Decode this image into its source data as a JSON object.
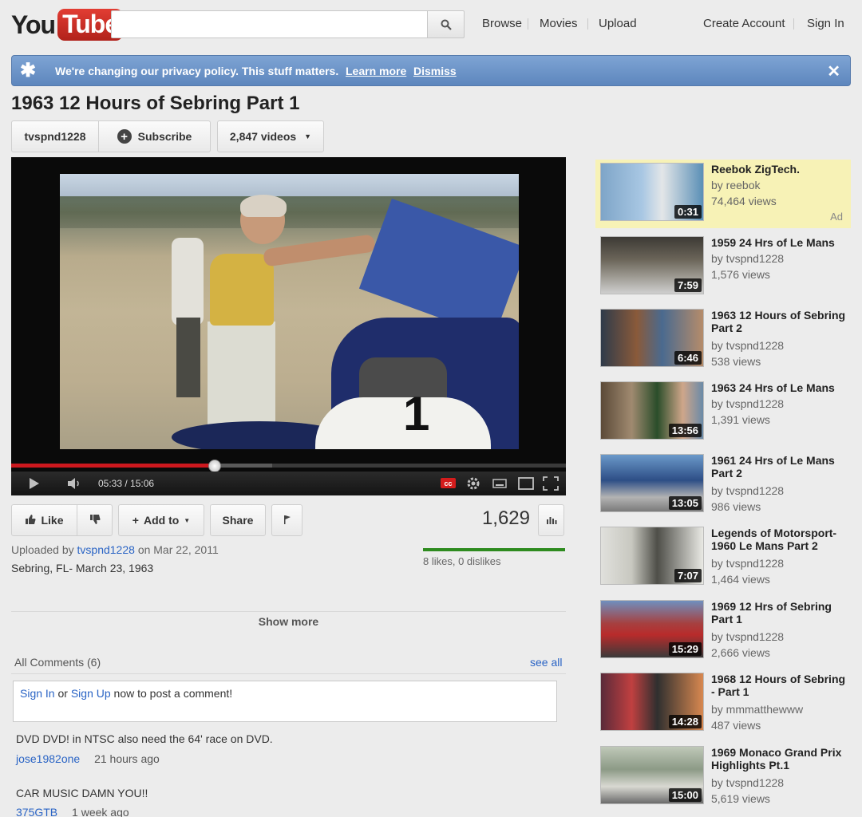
{
  "header": {
    "logo_you": "You",
    "logo_tube": "Tube",
    "search_value": "",
    "nav": [
      "Browse",
      "Movies",
      "Upload"
    ],
    "create_account": "Create Account",
    "sign_in": "Sign In"
  },
  "banner": {
    "text": "We're changing our privacy policy. This stuff matters.",
    "learn_more": "Learn more",
    "dismiss": "Dismiss",
    "color": "#6a92c8"
  },
  "video": {
    "title": "1963 12 Hours of Sebring Part 1",
    "channel": "tvspnd1228",
    "subscribe": "Subscribe",
    "video_count": "2,847 videos",
    "time_current": "05:33",
    "time_total": "15:06",
    "progress_played_fraction": 0.367,
    "progress_buffered_fraction": 0.47,
    "cc_label": "cc"
  },
  "actions": {
    "like": "Like",
    "add_to": "Add to",
    "share": "Share",
    "views": "1,629",
    "likes_text": "8 likes, 0 dislikes"
  },
  "info": {
    "uploaded_prefix": "Uploaded by",
    "uploader": "tvspnd1228",
    "uploaded_date": "on Mar 22, 2011",
    "description": "Sebring, FL- March 23, 1963",
    "show_more": "Show more"
  },
  "comments": {
    "header": "All Comments (6)",
    "see_all": "see all",
    "sign_in": "Sign In",
    "or": "or",
    "sign_up": "Sign Up",
    "prompt": "now to post a comment!",
    "items": [
      {
        "text": "DVD DVD! in NTSC also need the 64' race on DVD.",
        "user": "jose1982one",
        "time": "21 hours ago"
      },
      {
        "text": "CAR MUSIC DAMN YOU!!",
        "user": "375GTB",
        "time": "1 week ago"
      }
    ]
  },
  "sidebar": {
    "ad_label": "Ad",
    "items": [
      {
        "title": "Reebok ZigTech.",
        "by": "by reebok",
        "views": "74,464 views",
        "duration": "0:31",
        "ad": true
      },
      {
        "title": "1959 24 Hrs of Le Mans",
        "by": "by tvspnd1228",
        "views": "1,576 views",
        "duration": "7:59"
      },
      {
        "title": "1963 12 Hours of Sebring Part 2",
        "by": "by tvspnd1228",
        "views": "538 views",
        "duration": "6:46"
      },
      {
        "title": "1963 24 Hrs of Le Mans",
        "by": "by tvspnd1228",
        "views": "1,391 views",
        "duration": "13:56"
      },
      {
        "title": "1961 24 Hrs of Le Mans Part 2",
        "by": "by tvspnd1228",
        "views": "986 views",
        "duration": "13:05"
      },
      {
        "title": "Legends of Motorsport- 1960 Le Mans Part 2",
        "by": "by tvspnd1228",
        "views": "1,464 views",
        "duration": "7:07"
      },
      {
        "title": "1969 12 Hrs of Sebring Part 1",
        "by": "by tvspnd1228",
        "views": "2,666 views",
        "duration": "15:29"
      },
      {
        "title": "1968 12 Hours of Sebring - Part 1",
        "by": "by mmmatthewww",
        "views": "487 views",
        "duration": "14:28"
      },
      {
        "title": "1969 Monaco Grand Prix Highlights Pt.1",
        "by": "by tvspnd1228",
        "views": "5,619 views",
        "duration": "15:00"
      }
    ]
  }
}
